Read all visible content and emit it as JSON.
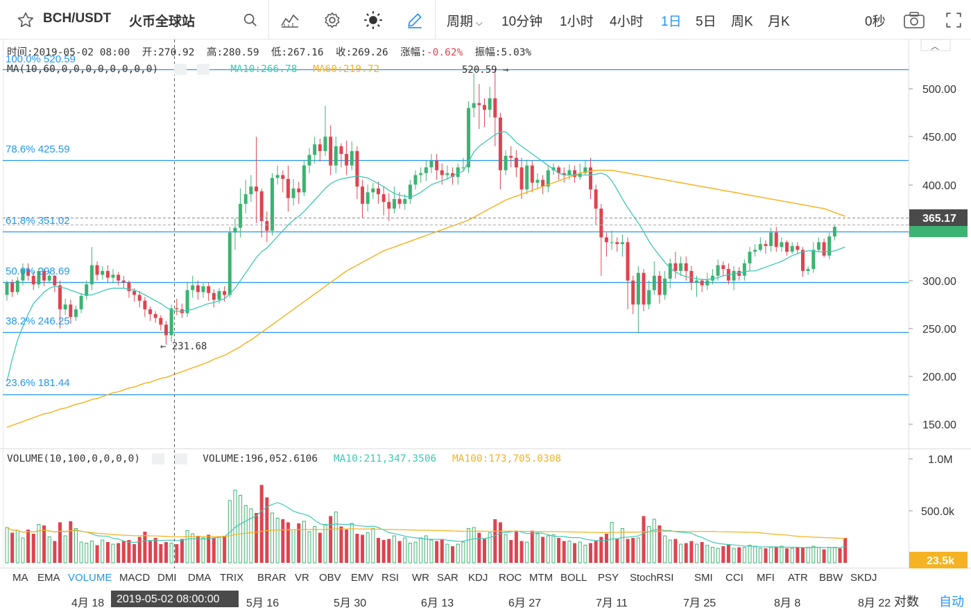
{
  "toolbar": {
    "symbol": "BCH/USDT",
    "exchange": "火币全球站",
    "periods": [
      "周期",
      "10分钟",
      "1小时",
      "4小时",
      "1日",
      "5日",
      "周K",
      "月K"
    ],
    "active_period": "1日",
    "countdown": "0秒"
  },
  "info": {
    "time": "时间:2019-05-02 08:00",
    "open": "开:270.92",
    "high": "高:280.59",
    "low": "低:267.16",
    "close": "收:269.26",
    "change_label": "涨幅:",
    "change_value": "-0.62%",
    "amplitude": "振幅:5.03%"
  },
  "ma_legend": {
    "name": "MA(10,60,0,0,0,0,0,0,0,0)",
    "ma10": "MA10:266.78",
    "ma60": "MA60:219.72"
  },
  "fib": [
    {
      "label": "100.0% 520.59",
      "value": 520.59
    },
    {
      "label": "78.6% 425.59",
      "value": 425.59
    },
    {
      "label": "61.8% 351.02",
      "value": 351.02
    },
    {
      "label": "50.0% 298.69",
      "value": 298.69
    },
    {
      "label": "38.2% 246.25",
      "value": 246.25
    },
    {
      "label": "23.6% 181.44",
      "value": 181.44
    }
  ],
  "high_marker": "520.59 →",
  "low_marker": "← 231.68",
  "price_axis": [
    "500.00",
    "450.00",
    "400.00",
    "350.00",
    "300.00",
    "250.00",
    "200.00",
    "150.00"
  ],
  "current_price": "365.17",
  "volume_legend": {
    "name": "VOLUME(10,100,0,0,0,0)",
    "volume": "VOLUME:196,052.6106",
    "ma10": "MA10:211,347.3506",
    "ma100": "MA100:173,705.0308"
  },
  "volume_axis": [
    "1.0M",
    "500.0k"
  ],
  "current_volume": "23.5k",
  "indicators": [
    "MA",
    "EMA",
    "VOLUME",
    "MACD",
    "DMI",
    "DMA",
    "TRIX",
    "BRAR",
    "VR",
    "OBV",
    "EMV",
    "RSI",
    "WR",
    "SAR",
    "KDJ",
    "ROC",
    "MTM",
    "BOLL",
    "PSY",
    "StochRSI",
    "SMI",
    "CCI",
    "MFI",
    "ATR",
    "BBW",
    "SKDJ"
  ],
  "active_indicator": "VOLUME",
  "date_axis": [
    "4月 18",
    "5月 16",
    "5月 30",
    "6月 13",
    "6月 27",
    "7月 11",
    "7月 25",
    "8月 8",
    "8月 22"
  ],
  "crosshair_date": "2019-05-02 08:00:00",
  "scale_mode": "对数",
  "auto_mode": "自动",
  "colors": {
    "up": "#3cb371",
    "down": "#e0434f",
    "ma10": "#3cc8b4",
    "ma60": "#f5b323",
    "fib": "#2196f3",
    "accent": "#2196f3"
  },
  "chart_data": {
    "type": "candlestick",
    "price_range": [
      120,
      540
    ],
    "candles": [
      [
        285,
        298,
        279,
        300
      ],
      [
        298,
        288,
        283,
        301
      ],
      [
        288,
        300,
        285,
        304
      ],
      [
        300,
        312,
        295,
        318
      ],
      [
        312,
        305,
        300,
        318
      ],
      [
        305,
        296,
        290,
        309
      ],
      [
        296,
        310,
        292,
        313
      ],
      [
        310,
        300,
        294,
        312
      ],
      [
        300,
        305,
        297,
        310
      ],
      [
        305,
        295,
        288,
        306
      ],
      [
        295,
        270,
        250,
        300
      ],
      [
        270,
        275,
        264,
        281
      ],
      [
        275,
        262,
        255,
        280
      ],
      [
        262,
        270,
        258,
        274
      ],
      [
        270,
        284,
        266,
        287
      ],
      [
        284,
        296,
        280,
        300
      ],
      [
        296,
        316,
        290,
        335
      ],
      [
        316,
        306,
        300,
        320
      ],
      [
        306,
        310,
        301,
        315
      ],
      [
        310,
        303,
        298,
        316
      ],
      [
        303,
        306,
        297,
        312
      ],
      [
        306,
        300,
        295,
        309
      ],
      [
        300,
        298,
        292,
        305
      ],
      [
        298,
        289,
        282,
        300
      ],
      [
        289,
        285,
        278,
        292
      ],
      [
        285,
        279,
        272,
        289
      ],
      [
        279,
        270,
        262,
        283
      ],
      [
        270,
        265,
        258,
        273
      ],
      [
        265,
        261,
        256,
        268
      ],
      [
        261,
        254,
        248,
        264
      ],
      [
        254,
        243,
        233,
        258
      ],
      [
        243,
        271,
        236,
        275
      ],
      [
        271,
        270,
        264,
        281
      ],
      [
        270,
        266,
        261,
        276
      ],
      [
        266,
        290,
        262,
        298
      ],
      [
        290,
        295,
        282,
        305
      ],
      [
        295,
        288,
        280,
        300
      ],
      [
        288,
        294,
        282,
        298
      ],
      [
        294,
        287,
        279,
        298
      ],
      [
        287,
        280,
        272,
        291
      ],
      [
        280,
        289,
        276,
        292
      ],
      [
        289,
        285,
        278,
        294
      ],
      [
        285,
        350,
        282,
        356
      ],
      [
        350,
        355,
        332,
        365
      ],
      [
        355,
        380,
        345,
        396
      ],
      [
        380,
        390,
        370,
        405
      ],
      [
        390,
        398,
        382,
        410
      ],
      [
        398,
        393,
        360,
        450
      ],
      [
        393,
        362,
        345,
        396
      ],
      [
        362,
        352,
        340,
        372
      ],
      [
        352,
        407,
        347,
        412
      ],
      [
        407,
        410,
        400,
        420
      ],
      [
        410,
        406,
        392,
        415
      ],
      [
        406,
        386,
        372,
        420
      ],
      [
        386,
        396,
        378,
        406
      ],
      [
        396,
        392,
        380,
        403
      ],
      [
        392,
        420,
        388,
        426
      ],
      [
        420,
        431,
        412,
        438
      ],
      [
        431,
        442,
        422,
        450
      ],
      [
        442,
        435,
        424,
        448
      ],
      [
        435,
        450,
        430,
        482
      ],
      [
        450,
        420,
        410,
        462
      ],
      [
        420,
        440,
        412,
        450
      ],
      [
        440,
        432,
        418,
        443
      ],
      [
        432,
        420,
        410,
        446
      ],
      [
        420,
        435,
        415,
        445
      ],
      [
        435,
        398,
        385,
        440
      ],
      [
        398,
        380,
        365,
        405
      ],
      [
        380,
        392,
        372,
        400
      ],
      [
        392,
        396,
        385,
        402
      ],
      [
        396,
        390,
        380,
        403
      ],
      [
        390,
        382,
        368,
        398
      ],
      [
        382,
        375,
        362,
        391
      ],
      [
        375,
        385,
        370,
        398
      ],
      [
        385,
        380,
        375,
        392
      ],
      [
        380,
        385,
        374,
        390
      ],
      [
        385,
        400,
        380,
        405
      ],
      [
        400,
        410,
        395,
        415
      ],
      [
        410,
        412,
        402,
        418
      ],
      [
        412,
        418,
        404,
        425
      ],
      [
        418,
        425,
        412,
        432
      ],
      [
        425,
        415,
        405,
        432
      ],
      [
        415,
        410,
        400,
        422
      ],
      [
        410,
        412,
        405,
        420
      ],
      [
        412,
        408,
        400,
        418
      ],
      [
        408,
        418,
        400,
        422
      ],
      [
        418,
        418,
        415,
        428
      ],
      [
        418,
        480,
        412,
        487
      ],
      [
        480,
        485,
        470,
        516
      ],
      [
        485,
        483,
        458,
        505
      ],
      [
        483,
        478,
        460,
        490
      ],
      [
        478,
        490,
        470,
        502
      ],
      [
        490,
        470,
        440,
        520
      ],
      [
        470,
        415,
        395,
        475
      ],
      [
        415,
        430,
        410,
        436
      ],
      [
        430,
        428,
        418,
        440
      ],
      [
        428,
        418,
        408,
        436
      ],
      [
        418,
        395,
        385,
        428
      ],
      [
        395,
        420,
        390,
        426
      ],
      [
        420,
        402,
        392,
        425
      ],
      [
        402,
        405,
        395,
        412
      ],
      [
        405,
        398,
        390,
        410
      ],
      [
        398,
        415,
        392,
        420
      ],
      [
        415,
        418,
        410,
        422
      ],
      [
        418,
        412,
        405,
        420
      ],
      [
        412,
        410,
        402,
        418
      ],
      [
        410,
        415,
        405,
        421
      ],
      [
        415,
        408,
        402,
        420
      ],
      [
        408,
        412,
        405,
        422
      ],
      [
        412,
        418,
        410,
        425
      ],
      [
        418,
        395,
        385,
        428
      ],
      [
        395,
        375,
        358,
        400
      ],
      [
        375,
        345,
        305,
        380
      ],
      [
        345,
        340,
        325,
        350
      ],
      [
        340,
        340,
        332,
        352
      ],
      [
        340,
        338,
        330,
        345
      ],
      [
        338,
        340,
        325,
        348
      ],
      [
        340,
        300,
        270,
        345
      ],
      [
        300,
        275,
        265,
        305
      ],
      [
        275,
        308,
        245,
        315
      ],
      [
        308,
        275,
        268,
        312
      ],
      [
        275,
        290,
        270,
        300
      ],
      [
        290,
        305,
        285,
        320
      ],
      [
        305,
        285,
        276,
        310
      ],
      [
        285,
        302,
        280,
        310
      ],
      [
        302,
        318,
        292,
        323
      ],
      [
        318,
        310,
        302,
        330
      ],
      [
        310,
        318,
        305,
        325
      ],
      [
        318,
        310,
        300,
        325
      ],
      [
        310,
        298,
        290,
        315
      ],
      [
        298,
        300,
        283,
        305
      ],
      [
        300,
        295,
        288,
        302
      ],
      [
        295,
        300,
        290,
        308
      ],
      [
        300,
        305,
        296,
        312
      ],
      [
        305,
        316,
        300,
        322
      ],
      [
        316,
        312,
        305,
        320
      ],
      [
        312,
        300,
        296,
        318
      ],
      [
        300,
        310,
        290,
        315
      ],
      [
        310,
        305,
        300,
        314
      ],
      [
        305,
        318,
        300,
        322
      ],
      [
        318,
        330,
        310,
        335
      ],
      [
        330,
        332,
        325,
        338
      ],
      [
        332,
        338,
        330,
        345
      ],
      [
        338,
        336,
        328,
        342
      ],
      [
        336,
        350,
        330,
        355
      ],
      [
        350,
        335,
        330,
        356
      ],
      [
        335,
        340,
        330,
        345
      ],
      [
        340,
        330,
        326,
        342
      ],
      [
        330,
        336,
        328,
        340
      ],
      [
        336,
        332,
        328,
        340
      ],
      [
        332,
        310,
        304,
        335
      ],
      [
        310,
        312,
        306,
        315
      ],
      [
        312,
        332,
        308,
        340
      ],
      [
        332,
        340,
        330,
        345
      ],
      [
        340,
        326,
        324,
        344
      ],
      [
        326,
        346,
        322,
        350
      ],
      [
        346,
        356,
        342,
        358
      ]
    ],
    "ma10": [
      195,
      218,
      238,
      252,
      265,
      276,
      282,
      288,
      292,
      294,
      293,
      292,
      290,
      288,
      286,
      285,
      285,
      287,
      289,
      291,
      292,
      292,
      292,
      291,
      290,
      288,
      285,
      282,
      279,
      276,
      272,
      269,
      268,
      268,
      269,
      270,
      272,
      274,
      276,
      277,
      279,
      281,
      286,
      292,
      300,
      308,
      316,
      324,
      330,
      334,
      340,
      346,
      352,
      358,
      363,
      367,
      372,
      378,
      384,
      390,
      396,
      401,
      404,
      406,
      407,
      408,
      409,
      408,
      407,
      404,
      401,
      398,
      394,
      391,
      389,
      388,
      387,
      389,
      392,
      396,
      400,
      402,
      404,
      406,
      409,
      412,
      414,
      424,
      434,
      440,
      444,
      448,
      452,
      455,
      455,
      450,
      444,
      440,
      436,
      432,
      428,
      424,
      420,
      416,
      412,
      410,
      410,
      410,
      410,
      410,
      410,
      411,
      412,
      410,
      404,
      395,
      385,
      376,
      368,
      360,
      351,
      341,
      333,
      326,
      319,
      313,
      309,
      306,
      304,
      303,
      302,
      301,
      301,
      302,
      303,
      305,
      306,
      307,
      308,
      309,
      310,
      310,
      312,
      314,
      316,
      318,
      320,
      323,
      326,
      328,
      330,
      331,
      331,
      330,
      330,
      330,
      331,
      333,
      335
    ],
    "ma60": [
      147,
      149,
      151,
      153,
      155,
      157,
      159,
      161,
      162,
      164,
      166,
      167,
      169,
      171,
      172,
      174,
      176,
      177,
      179,
      181,
      183,
      184,
      186,
      188,
      189,
      191,
      193,
      194,
      196,
      198,
      199,
      201,
      203,
      205,
      207,
      209,
      211,
      213,
      215,
      218,
      220,
      222,
      225,
      228,
      231,
      235,
      238,
      242,
      246,
      250,
      254,
      258,
      262,
      266,
      270,
      274,
      278,
      282,
      286,
      290,
      294,
      298,
      302,
      306,
      310,
      313,
      316,
      319,
      322,
      325,
      328,
      331,
      333,
      335,
      337,
      339,
      341,
      343,
      345,
      347,
      349,
      351,
      353,
      355,
      357,
      359,
      361,
      363,
      366,
      369,
      372,
      375,
      378,
      381,
      384,
      386,
      388,
      390,
      392,
      394,
      396,
      398,
      400,
      402,
      404,
      406,
      408,
      410,
      412,
      413,
      414,
      415,
      415,
      415,
      415,
      414,
      413,
      412,
      411,
      410,
      409,
      408,
      407,
      406,
      405,
      404,
      403,
      402,
      401,
      400,
      399,
      398,
      397,
      396,
      395,
      394,
      393,
      392,
      391,
      390,
      389,
      388,
      387,
      386,
      385,
      384,
      383,
      382,
      381,
      380,
      379,
      378,
      377,
      376,
      375,
      373,
      371,
      369,
      367
    ],
    "volume_range": [
      0,
      1000000
    ],
    "volume": [
      340,
      290,
      310,
      240,
      320,
      280,
      370,
      360,
      250,
      210,
      390,
      260,
      400,
      330,
      200,
      190,
      210,
      170,
      220,
      200,
      180,
      190,
      210,
      220,
      180,
      250,
      300,
      210,
      240,
      180,
      200,
      190,
      180,
      230,
      310,
      280,
      260,
      240,
      270,
      240,
      250,
      260,
      600,
      700,
      650,
      550,
      520,
      480,
      750,
      630,
      480,
      430,
      420,
      390,
      320,
      380,
      400,
      300,
      350,
      290,
      370,
      450,
      490,
      350,
      320,
      380,
      280,
      270,
      290,
      330,
      240,
      220,
      230,
      260,
      210,
      240,
      190,
      200,
      240,
      260,
      220,
      210,
      230,
      180,
      160,
      180,
      200,
      330,
      340,
      290,
      230,
      290,
      420,
      390,
      270,
      220,
      300,
      210,
      200,
      310,
      280,
      250,
      260,
      270,
      240,
      210,
      210,
      190,
      200,
      170,
      190,
      210,
      250,
      280,
      390,
      230,
      330,
      230,
      240,
      240,
      450,
      350,
      420,
      360,
      260,
      220,
      230,
      180,
      190,
      210,
      180,
      200,
      170,
      150,
      140,
      160,
      180,
      140,
      150,
      150,
      170,
      160,
      140,
      140,
      150,
      150,
      160,
      140,
      140,
      150,
      150,
      150,
      160,
      150,
      130,
      150,
      150,
      140,
      240
    ]
  }
}
